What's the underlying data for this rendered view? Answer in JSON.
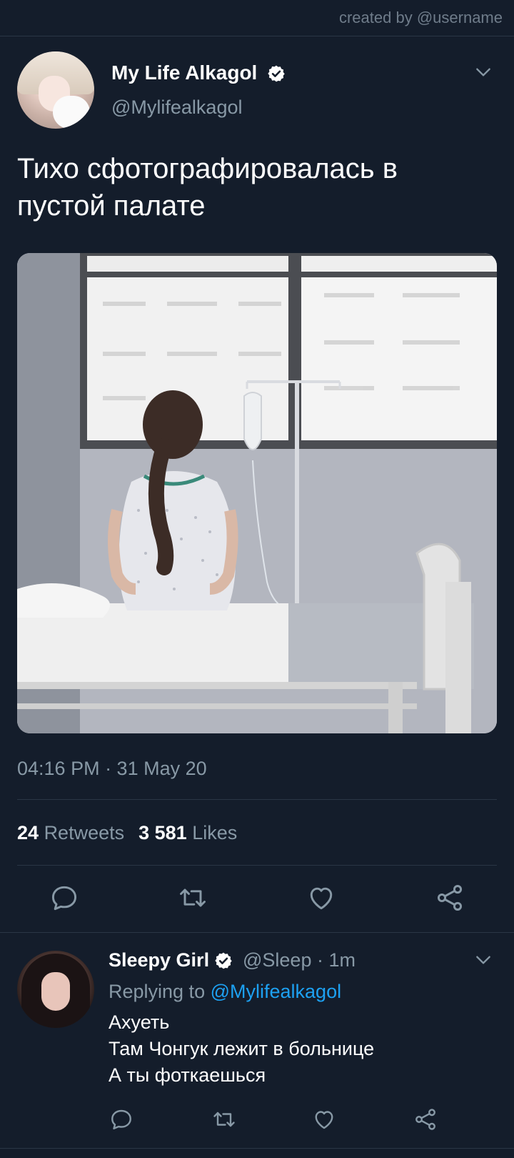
{
  "header": {
    "created_by": "created by @username"
  },
  "tweet": {
    "author_name": "My Life Alkagol",
    "author_handle": "@Mylifealkagol",
    "text_line1": "Тихо сфотографировалась в",
    "text_line2": "пустой палате",
    "timestamp": "04:16 PM · 31 May 20",
    "retweets_count": "24",
    "retweets_label": "Retweets",
    "likes_count": "3 581",
    "likes_label": "Likes"
  },
  "reply": {
    "author_name": "Sleepy Girl",
    "author_handle_time": "@Sleep · 1m",
    "replying_prefix": "Replying to",
    "replying_to": "@Mylifealkagol",
    "lines": [
      "Ахуеть",
      "Там Чонгук лежит в больнице",
      "А ты фоткаешься"
    ]
  },
  "icons": {
    "verified": "verified-badge-icon",
    "chevron": "chevron-down-icon",
    "reply": "reply-icon",
    "retweet": "retweet-icon",
    "like": "heart-icon",
    "share": "share-icon"
  },
  "colors": {
    "background": "#141d2b",
    "secondary_text": "#8899a6",
    "link": "#1da1f2",
    "divider": "#2a3645"
  }
}
